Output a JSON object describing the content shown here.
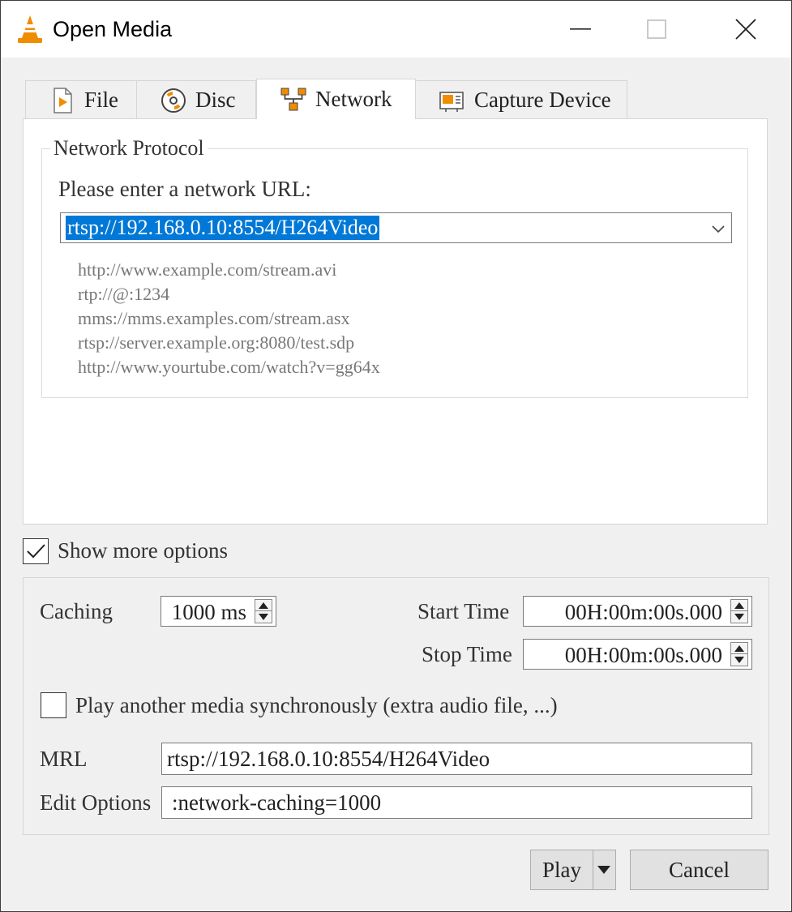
{
  "window": {
    "title": "Open Media",
    "app_icon": "vlc-cone-icon",
    "controls": [
      "minimize-icon",
      "maximize-icon",
      "close-icon"
    ]
  },
  "tabs": [
    {
      "label": "File",
      "icon": "file-play-icon",
      "active": false
    },
    {
      "label": "Disc",
      "icon": "disc-icon",
      "active": false
    },
    {
      "label": "Network",
      "icon": "network-icon",
      "active": true
    },
    {
      "label": "Capture Device",
      "icon": "capture-device-icon",
      "active": false
    }
  ],
  "network": {
    "group_title": "Network Protocol",
    "url_label": "Please enter a network URL:",
    "url_value": "rtsp://192.168.0.10:8554/H264Video",
    "examples": [
      "http://www.example.com/stream.avi",
      "rtp://@:1234",
      "mms://mms.examples.com/stream.asx",
      "rtsp://server.example.org:8080/test.sdp",
      "http://www.yourtube.com/watch?v=gg64x"
    ]
  },
  "show_more": {
    "label": "Show more options",
    "checked": true
  },
  "options": {
    "caching_label": "Caching",
    "caching_value": "1000 ms",
    "start_time_label": "Start Time",
    "start_time_value": "00H:00m:00s.000",
    "stop_time_label": "Stop Time",
    "stop_time_value": "00H:00m:00s.000",
    "sync_label": "Play another media synchronously (extra audio file, ...)",
    "sync_checked": false,
    "mrl_label": "MRL",
    "mrl_value": "rtsp://192.168.0.10:8554/H264Video",
    "edit_options_label": "Edit Options",
    "edit_options_value": ":network-caching=1000"
  },
  "buttons": {
    "play": "Play",
    "cancel": "Cancel"
  },
  "colors": {
    "selection": "#0078d7",
    "vlc_orange": "#f08c00",
    "panel_bg": "#f0f0f0"
  }
}
